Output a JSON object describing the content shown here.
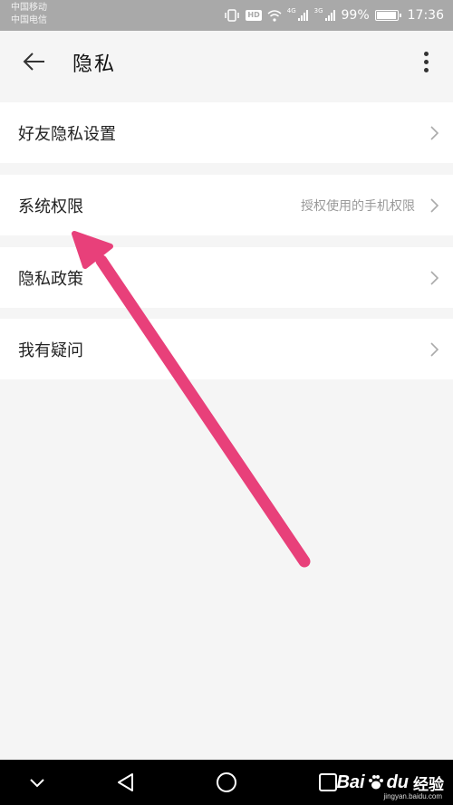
{
  "status_bar": {
    "carrier_1": "中国移动",
    "carrier_2": "中国电信",
    "network_1": "4G",
    "network_2": "3G",
    "hd_badge": "HD",
    "battery_text": "99%",
    "battery_level": 0.99,
    "time": "17:36",
    "icons": [
      "vibrate-icon",
      "hd-icon",
      "wifi-icon",
      "signal-icon",
      "signal-icon",
      "battery-icon"
    ]
  },
  "header": {
    "title": "隐私",
    "back_icon": "back-arrow-icon",
    "more_icon": "more-vertical-icon"
  },
  "menu": {
    "items": [
      {
        "label": "好友隐私设置",
        "hint": ""
      },
      {
        "label": "系统权限",
        "hint": "授权使用的手机权限"
      },
      {
        "label": "隐私政策",
        "hint": ""
      },
      {
        "label": "我有疑问",
        "hint": ""
      }
    ]
  },
  "annotation": {
    "color": "#e8407a",
    "target": "系统权限"
  },
  "nav_bar": {
    "icons": [
      "chevron-down-icon",
      "back-triangle-icon",
      "home-circle-icon",
      "recents-square-icon"
    ]
  },
  "watermark": {
    "brand_1": "Bai",
    "brand_2": "du",
    "brand_3": "经验",
    "url": "jingyan.baidu.com"
  },
  "colors": {
    "status_bar": "#a9a9a9",
    "background": "#f5f5f5",
    "row": "#ffffff",
    "hint": "#9a9a9a",
    "nav_bar": "#000000"
  }
}
